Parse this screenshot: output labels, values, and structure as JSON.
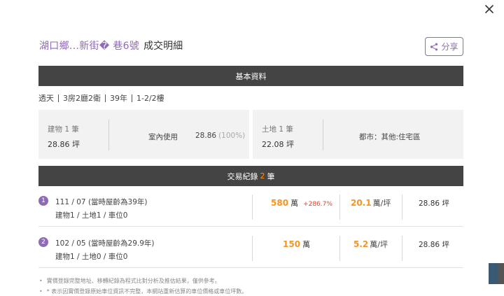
{
  "title": {
    "address": "湖口鄉.‥新街�  巷6號",
    "suffix": "成交明細"
  },
  "share_label": "分享",
  "sections": {
    "basic": "基本資料",
    "transactions_prefix": "交易紀錄",
    "transactions_count": "2",
    "transactions_suffix": "筆"
  },
  "summary": [
    "透天",
    "3房2廳2衛",
    "39年",
    "1-2/2樓"
  ],
  "building": {
    "label": "建物 1 筆",
    "value": "28.86 坪",
    "use_label": "室內使用",
    "use_value": "28.86",
    "use_pct": "(100%)"
  },
  "land": {
    "label": "土地 1 筆",
    "value": "22.08 坪",
    "zone": "都市：其他:住宅區"
  },
  "transactions": [
    {
      "index": "1",
      "date": "111 / 07 (當時屋齡為39年)",
      "detail": "建物1 / 土地1 / 車位0",
      "price": "580",
      "price_unit": "萬",
      "price_change": "+286.7%",
      "unit_price": "20.1",
      "unit_price_unit": "萬/坪",
      "area": "28.86 坪"
    },
    {
      "index": "2",
      "date": "102 / 05 (當時屋齡為29.9年)",
      "detail": "建物1 / 土地0 / 車位0",
      "price": "150",
      "price_unit": "萬",
      "price_change": "",
      "unit_price": "5.2",
      "unit_price_unit": "萬/坪",
      "area": "28.86 坪"
    }
  ],
  "notes": [
    "實價登錄完整地址、移轉紀錄為程式比對分析及推估結果，僅供參考。",
    "* 表示因實價登錄原始車位資訊不完整，本網站重新估算的車位價格或車位坪數。"
  ],
  "icons": {
    "close": "close-icon",
    "share": "share-icon"
  },
  "colors": {
    "accent": "#8e6bb5",
    "highlight": "#f7931e",
    "increase": "#e0432a",
    "bar": "#444444"
  }
}
